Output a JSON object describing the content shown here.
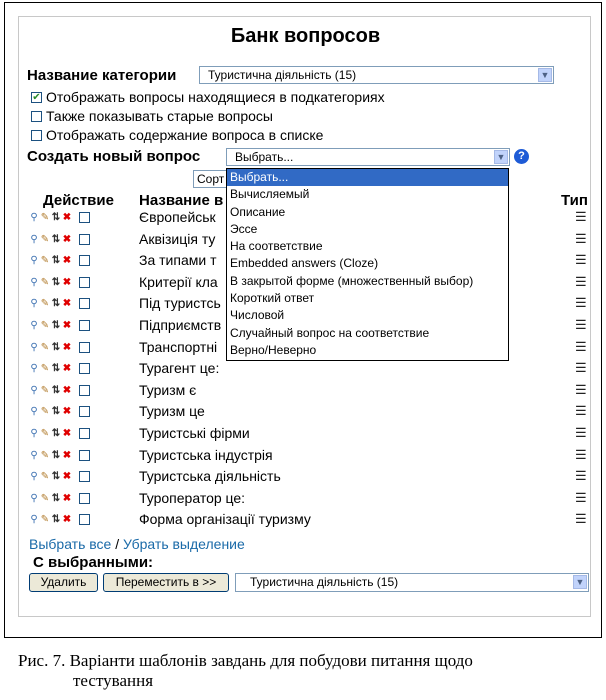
{
  "title": "Банк вопросов",
  "category": {
    "label": "Название категории",
    "value": "Туристична діяльність (15)"
  },
  "options": [
    {
      "label": "Отображать вопросы находящиеся в подкатегориях",
      "checked": true
    },
    {
      "label": "Также показывать старые вопросы",
      "checked": false
    },
    {
      "label": "Отображать содержание вопроса в списке",
      "checked": false
    }
  ],
  "create": {
    "label": "Создать новый вопрос",
    "select_value": "Выбрать...",
    "help_icon": "question-mark-icon"
  },
  "sort_stub": "Сорт",
  "table": {
    "col_action": "Действие",
    "col_name": "Название в",
    "col_type": "Тип",
    "rows": [
      "Європейськ",
      "Аквізиція ту",
      "За типами т",
      "Критерії кла",
      "Під туристсь",
      "Підприємств",
      "Транспортні",
      "Турагент це:",
      "Туризм є",
      "Туризм це",
      "Туристські фірми",
      "Туристська індустрія",
      "Туристська діяльність",
      "Туроператор це:",
      "Форма організації туризму"
    ]
  },
  "dropdown": {
    "items": [
      "Выбрать...",
      "Вычисляемый",
      "Описание",
      "Эссе",
      "На соответствие",
      "Embedded answers (Cloze)",
      "В закрытой форме (множественный выбор)",
      "Короткий ответ",
      "Числовой",
      "Случайный вопрос на соответствие",
      "Верно/Неверно"
    ],
    "selected_index": 0
  },
  "links": {
    "select_all": "Выбрать все",
    "separator": " / ",
    "deselect": "Убрать выделение"
  },
  "with_selected": {
    "label": "С выбранными:",
    "delete": "Удалить",
    "move": "Переместить в >>",
    "target": "Туристична діяльність (15)"
  },
  "caption": {
    "line1": "Рис. 7. Варіанти шаблонів завдань для побудови питання щодо",
    "line2": "тестування"
  },
  "colors": {
    "link": "#1a6aa8",
    "dropdown_highlight": "#316ac5",
    "delete_icon": "#e00000"
  }
}
